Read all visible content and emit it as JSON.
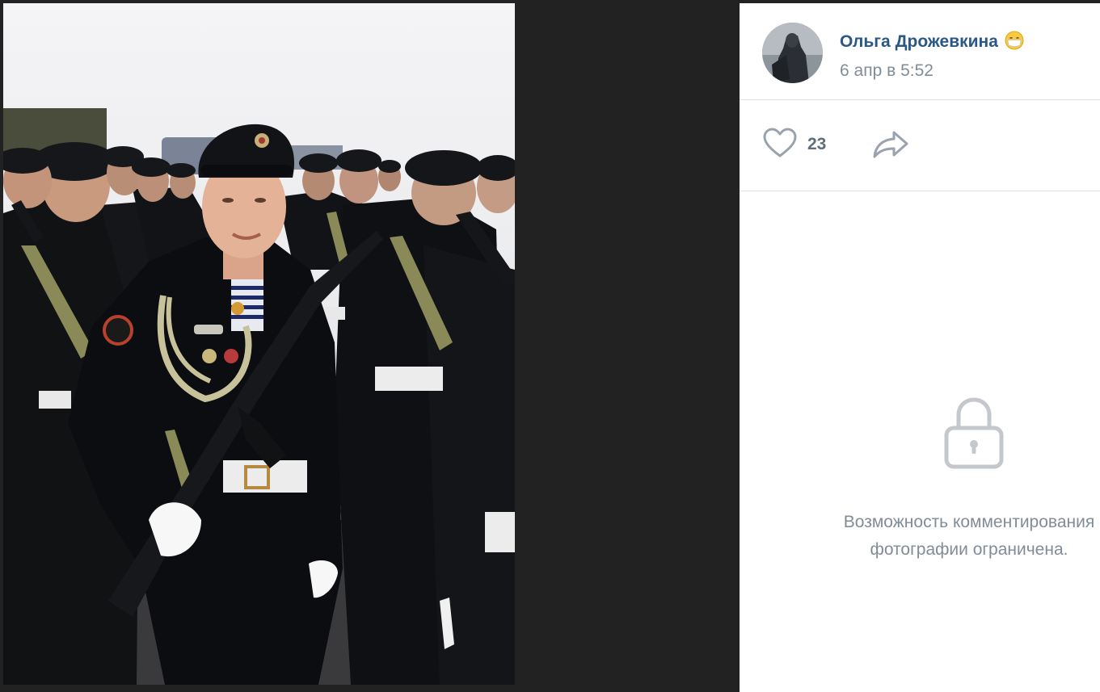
{
  "post": {
    "author_name": "Ольга Дрожевкина",
    "author_emoji": "mask-face-emoji",
    "date": "6 апр в 5:52",
    "likes": "23"
  },
  "comments": {
    "restricted_line1": "Возможность комментирования",
    "restricted_line2": "фотографии ограничена."
  },
  "icons": {
    "like": "heart-icon",
    "share": "share-arrow-icon",
    "lock": "lock-icon"
  },
  "colors": {
    "author_link": "#2a5885",
    "secondary_text": "#818c99",
    "icon_gray": "#99a2ad",
    "viewer_background": "#222222"
  }
}
